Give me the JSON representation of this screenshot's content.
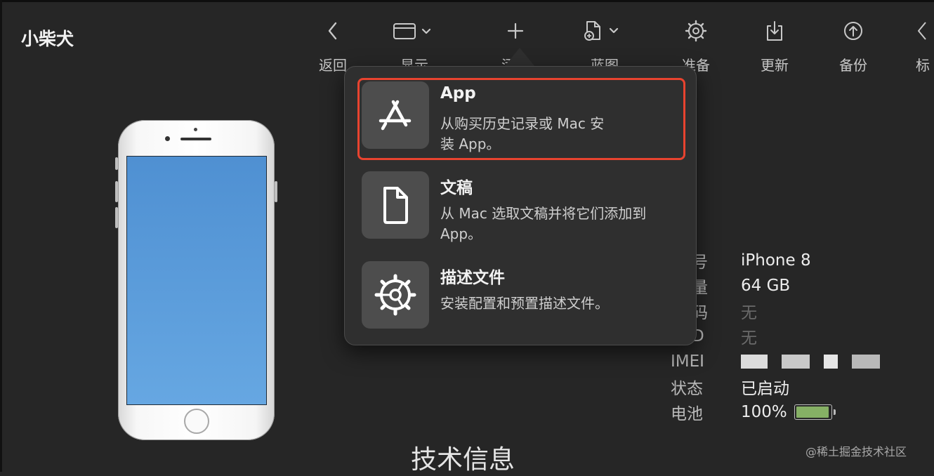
{
  "device_name": "小柴犬",
  "toolbar": [
    {
      "label": "返回",
      "icon": "chevron-left-icon"
    },
    {
      "label": "显示",
      "icon": "window-icon"
    },
    {
      "label": "添加",
      "icon": "plus-icon"
    },
    {
      "label": "蓝图",
      "icon": "blueprint-icon"
    },
    {
      "label": "准备",
      "icon": "gear-icon"
    },
    {
      "label": "更新",
      "icon": "download-icon"
    },
    {
      "label": "备份",
      "icon": "upload-icon"
    },
    {
      "label": "标",
      "icon": "tag-icon"
    }
  ],
  "add_menu": [
    {
      "title": "App",
      "description": "从购买历史记录或 Mac 安装 App。",
      "icon": "app-store-icon"
    },
    {
      "title": "文稿",
      "description": "从 Mac 选取文稿并将它们添加到 App。",
      "icon": "document-icon"
    },
    {
      "title": "描述文件",
      "description": "安装配置和预置描述文件。",
      "icon": "profile-gear-icon"
    }
  ],
  "info": {
    "model": {
      "label": "号",
      "value": "iPhone 8"
    },
    "capacity": {
      "label": "量",
      "value": "64 GB"
    },
    "code": {
      "label": "码",
      "value": "无"
    },
    "id": {
      "label": "D",
      "value": "无"
    },
    "imei": {
      "label": "IMEI"
    },
    "status": {
      "label": "状态",
      "value": "已启动"
    },
    "battery": {
      "label": "电池",
      "value": "100%",
      "level": 1.0,
      "color": "#86b065"
    }
  },
  "tech_info_title": "技术信息",
  "watermark": "@稀土掘金技术社区",
  "colors": {
    "background": "#262626",
    "highlight": "#e8432f",
    "popover": "#2f2f2f"
  }
}
